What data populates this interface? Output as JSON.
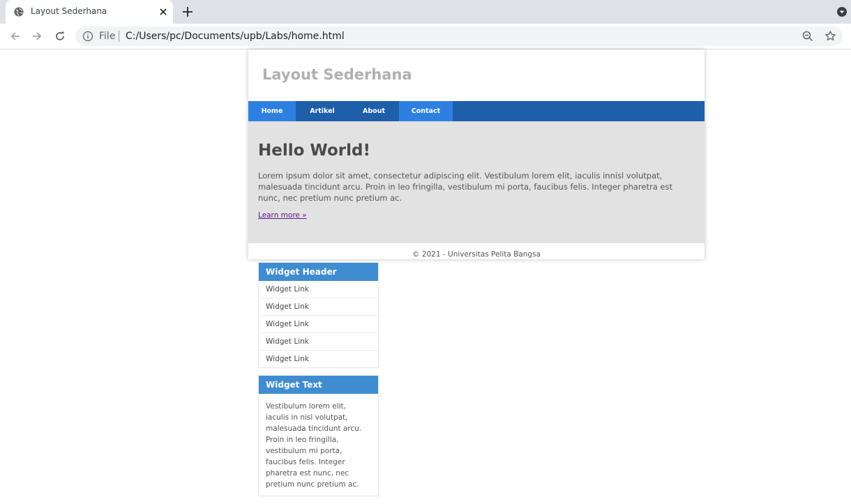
{
  "browser": {
    "tab_title": "Layout Sederhana",
    "address_scheme": "File",
    "url": "C:/Users/pc/Documents/upb/Labs/home.html"
  },
  "site": {
    "title": "Layout Sederhana",
    "nav": [
      {
        "label": "Home",
        "active": true
      },
      {
        "label": "Artikel",
        "active": false
      },
      {
        "label": "About",
        "active": false
      },
      {
        "label": "Contact",
        "active": true
      }
    ],
    "hero": {
      "heading": "Hello World!",
      "text": "Lorem ipsum dolor sit amet, consectetur adipiscing elit. Vestibulum lorem elit, iaculis innisl volutpat, malesuada tincidunt arcu. Proin in leo fringilla, vestibulum mi porta, faucibus felis. Integer pharetra est nunc, nec pretium nunc pretium ac.",
      "link": "Learn more »"
    },
    "footer": "© 2021 - Universitas Pelita Bangsa"
  },
  "sidebar": {
    "links_widget": {
      "header": "Widget Header",
      "links": [
        "Widget Link",
        "Widget Link",
        "Widget Link",
        "Widget Link",
        "Widget Link"
      ]
    },
    "text_widget": {
      "header": "Widget Text",
      "text": "Vestibulum lorem elit, iaculis in nisl volutpat, malesuada tincidunt arcu. Proin in leo fringilla, vestibulum mi porta, faucibus felis. Integer pharetra est nunc, nec pretium nunc pretium ac."
    }
  },
  "colors": {
    "nav_background": "#1f5faa",
    "nav_active": "#2d80e2",
    "widget_header": "#3f8dd0",
    "hero_background": "#e2e2e2"
  }
}
